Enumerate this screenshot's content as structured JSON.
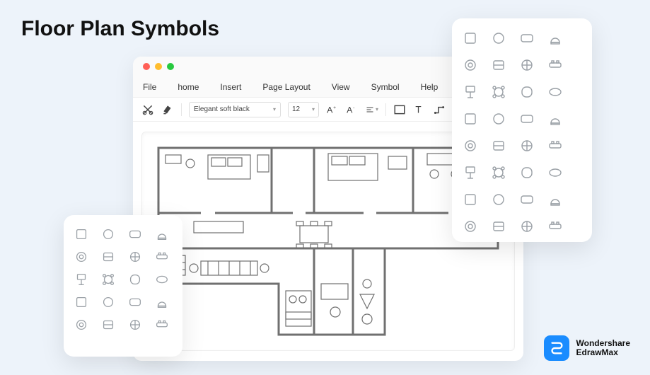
{
  "page": {
    "title": "Floor Plan Symbols"
  },
  "menu": {
    "file": "File",
    "home": "home",
    "insert": "Insert",
    "page_layout": "Page Layout",
    "view": "View",
    "symbol": "Symbol",
    "help": "Help"
  },
  "toolbar": {
    "font_name": "Elegant soft black",
    "font_size": "12"
  },
  "brand": {
    "line1": "Wondershare",
    "line2": "EdrawMax"
  },
  "palettes": {
    "right": [
      "chair-square",
      "chair-back",
      "chair-round",
      "armchair",
      "chair-circle",
      "chair-u",
      "chair-dome",
      "chair-box",
      "stool",
      "chair-side",
      "chair-pad",
      "sofa-small",
      "desk-monitor",
      "desk-lamp",
      "desk-double",
      "desk-triple",
      "table-round-4",
      "table-round-6",
      "table-star",
      "table-spoke",
      "shape-rounded",
      "shape-circle",
      "shape-square",
      "shape-oblong",
      "table-ring",
      "ottoman",
      "cushion",
      "table-many",
      "stool-4",
      "bench",
      "stool-pair",
      "table-petal"
    ],
    "left": [
      "corner-desk",
      "chairs-pair",
      "table-4",
      "table-group",
      "table-6",
      "cluster",
      "cluster-alt",
      "table-8",
      "cluster-square",
      "table-long",
      "conference",
      "table-round",
      "seating-a",
      "seating-b",
      "seating-c",
      "seating-d",
      "module-a",
      "module-b",
      "module-c",
      "module-d"
    ]
  }
}
